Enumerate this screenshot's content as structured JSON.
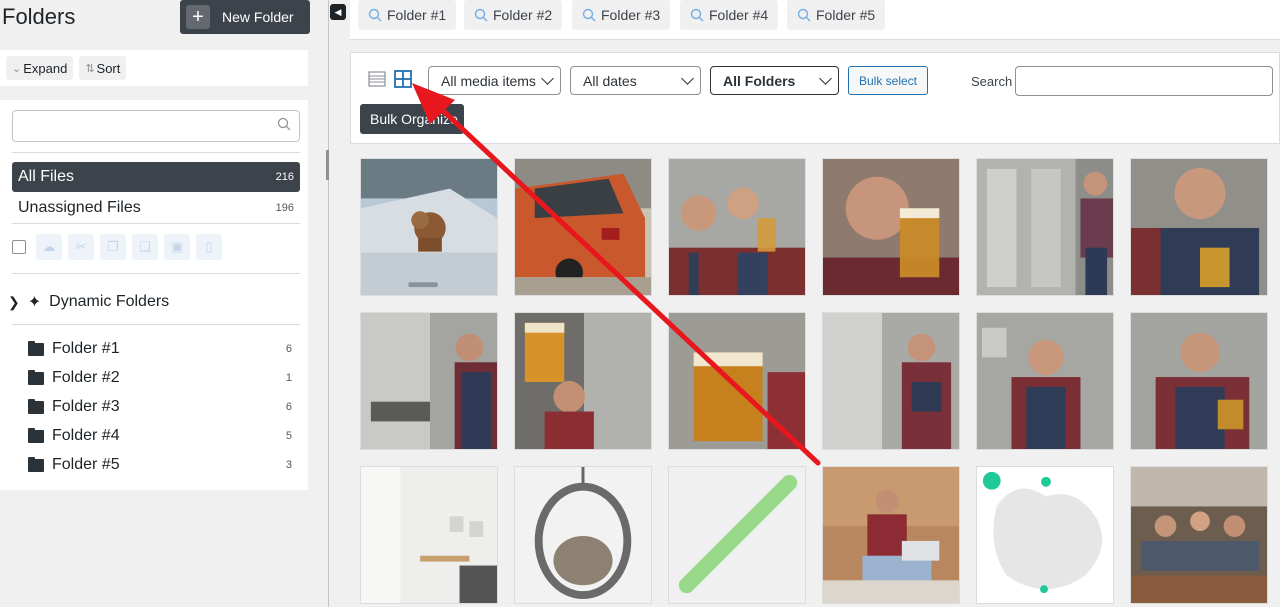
{
  "sidebar": {
    "title": "Folders",
    "new_folder_label": "New Folder",
    "expand_label": "Expand",
    "sort_label": "Sort",
    "search_placeholder": "",
    "all_files": {
      "label": "All Files",
      "count": "216"
    },
    "unassigned": {
      "label": "Unassigned Files",
      "count": "196"
    },
    "dynamic_label": "Dynamic Folders",
    "folders": [
      {
        "label": "Folder #1",
        "count": "6"
      },
      {
        "label": "Folder #2",
        "count": "1"
      },
      {
        "label": "Folder #3",
        "count": "6"
      },
      {
        "label": "Folder #4",
        "count": "5"
      },
      {
        "label": "Folder #5",
        "count": "3"
      }
    ]
  },
  "tabs": [
    {
      "label": "Folder #1"
    },
    {
      "label": "Folder #2"
    },
    {
      "label": "Folder #3"
    },
    {
      "label": "Folder #4"
    },
    {
      "label": "Folder #5"
    }
  ],
  "toolbar": {
    "media_filter": "All media items",
    "date_filter": "All dates",
    "folder_filter": "All Folders",
    "bulk_select_label": "Bulk select",
    "search_label": "Search",
    "search_value": "",
    "tooltip": "Bulk Organize"
  },
  "colors": {
    "accent": "#2271b1",
    "dark": "#3c434a",
    "annotation_arrow": "#e8161d"
  }
}
